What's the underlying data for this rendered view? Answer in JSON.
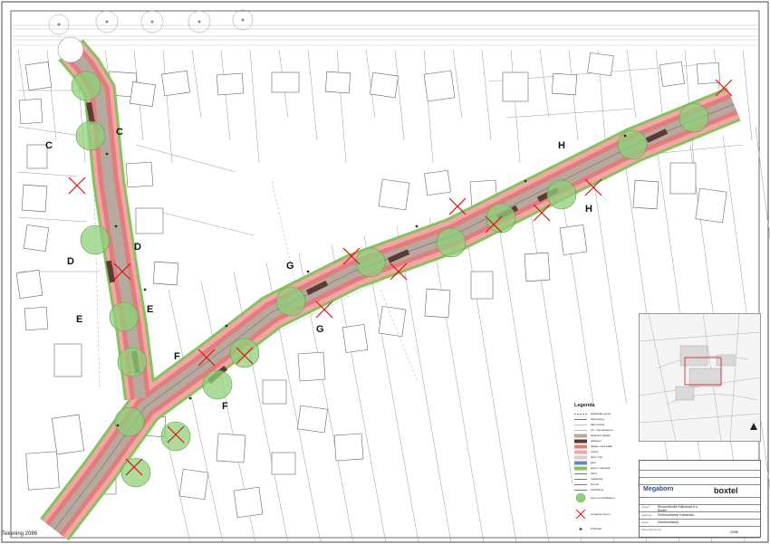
{
  "sheet": {
    "footer_label": "Tekening 2086",
    "border_color": "#666666"
  },
  "section_letters": [
    {
      "text": "C",
      "side": "left"
    },
    {
      "text": "C",
      "side": "right"
    },
    {
      "text": "D",
      "side": "left"
    },
    {
      "text": "D",
      "side": "right"
    },
    {
      "text": "E",
      "side": "left"
    },
    {
      "text": "E",
      "side": "right"
    },
    {
      "text": "F",
      "side": "left"
    },
    {
      "text": "F",
      "side": "right"
    },
    {
      "text": "G",
      "side": "top"
    },
    {
      "text": "G",
      "side": "bottom"
    },
    {
      "text": "H",
      "side": "top"
    },
    {
      "text": "H",
      "side": "bottom"
    }
  ],
  "colors": {
    "road_red": "#e37c7c",
    "road_pink": "#f2a6a6",
    "cycle_grey": "#b7a99e",
    "parking_dark": "#5a3a33",
    "green_verge": "#86c25e",
    "tree_fill": "#8fd07a",
    "tree_cross": "#e01010",
    "lot_lines": "#9a9a9a",
    "blue_lines": "#9aaed0"
  },
  "legend": {
    "title": "Legenda",
    "items": [
      {
        "symbol": "line-dash",
        "label": "kadastrale grens"
      },
      {
        "symbol": "line",
        "label": "bebouwing"
      },
      {
        "symbol": "line-thin",
        "label": "dak contour"
      },
      {
        "symbol": "line-thin",
        "label": "erf- / perceelgrens"
      },
      {
        "symbol": "fill-grey",
        "label": "fietspad / rijbaan"
      },
      {
        "symbol": "fill-dark",
        "label": "parkeren"
      },
      {
        "symbol": "fill-red",
        "label": "rijbaan rood asfalt"
      },
      {
        "symbol": "fill-pink",
        "label": "trottoir"
      },
      {
        "symbol": "fill-grey2",
        "label": "uitrit / inrit"
      },
      {
        "symbol": "fill-blue",
        "label": "goot"
      },
      {
        "symbol": "fill-green",
        "label": "groen / plantvak"
      },
      {
        "symbol": "line",
        "label": "band"
      },
      {
        "symbol": "line",
        "label": "markering"
      },
      {
        "symbol": "line",
        "label": "bomen"
      },
      {
        "symbol": "line",
        "label": "verlichting"
      }
    ],
    "tree_label": "boom te handhaven",
    "cross_label": "te kappen boom",
    "lamp_label": "lichtmast"
  },
  "titleblock": {
    "company": "Megaborn",
    "client": "boxtel",
    "project_label": "project",
    "project": "Reconstructie Kalkstraat e.o.",
    "place": "Boxtel",
    "drawing_label": "tekening",
    "drawing": "Schetsontwerp Kalkstraat",
    "phase_label": "status",
    "phase": "Schetsontwerp",
    "number_label": "tekeningnummer",
    "number": "2086"
  }
}
